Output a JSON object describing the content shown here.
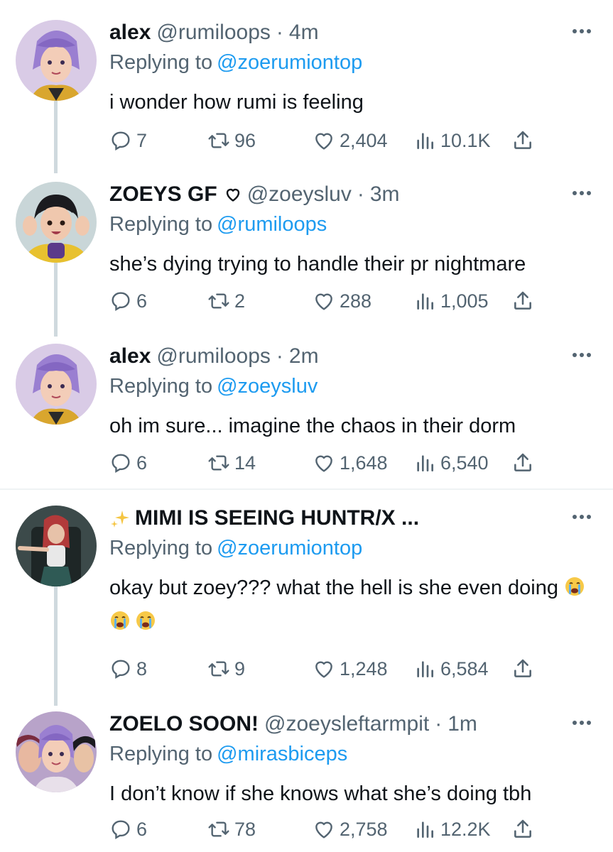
{
  "tweets": [
    {
      "name": "alex",
      "handle": "@rumiloops",
      "time": "4m",
      "replying_label": "Replying to",
      "replying_to": "@zoerumiontop",
      "text": "i wonder how rumi is feeling",
      "replies": "7",
      "retweets": "96",
      "likes": "2,404",
      "views": "10.1K",
      "avatar": "purple-braided-hair-character"
    },
    {
      "name": "ZOEYS GF",
      "handle": "@zoeysluv",
      "time": "3m",
      "replying_label": "Replying to",
      "replying_to": "@rumiloops",
      "text": "she’s dying trying to handle their pr nightmare",
      "replies": "6",
      "retweets": "2",
      "likes": "288",
      "views": "1,005",
      "avatar": "black-hair-yellow-jacket-character"
    },
    {
      "name": "alex",
      "handle": "@rumiloops",
      "time": "2m",
      "replying_label": "Replying to",
      "replying_to": "@zoeysluv",
      "text": "oh im sure... imagine the chaos in their dorm",
      "replies": "6",
      "retweets": "14",
      "likes": "1,648",
      "views": "6,540",
      "avatar": "purple-braided-hair-character"
    },
    {
      "name": "MIMI IS SEEING HUNTR/X ...",
      "handle": "",
      "time": "",
      "replying_label": "Replying to",
      "replying_to": "@zoerumiontop",
      "text": "okay but zoey??? what the hell is she even doing",
      "replies": "8",
      "retweets": "9",
      "likes": "1,248",
      "views": "6,584",
      "avatar": "red-hair-character-on-throne"
    },
    {
      "name": "ZOELO SOON!",
      "handle": "@zoeysleftarmpit",
      "time": "1m",
      "replying_label": "Replying to",
      "replying_to": "@mirasbiceps",
      "text": "I don’t know if she knows what she’s doing tbh",
      "replies": "6",
      "retweets": "78",
      "likes": "2,758",
      "views": "12.2K",
      "avatar": "three-characters-group"
    }
  ],
  "colors": {
    "text": "#0f1419",
    "secondary": "#536471",
    "link": "#1d9bf0",
    "thread_line": "#cfd9de"
  },
  "icons": [
    "reply-icon",
    "retweet-icon",
    "like-icon",
    "views-icon",
    "share-icon",
    "more-icon",
    "heart-outline-icon",
    "sparkles-icon",
    "loudly-crying-face-emoji"
  ]
}
